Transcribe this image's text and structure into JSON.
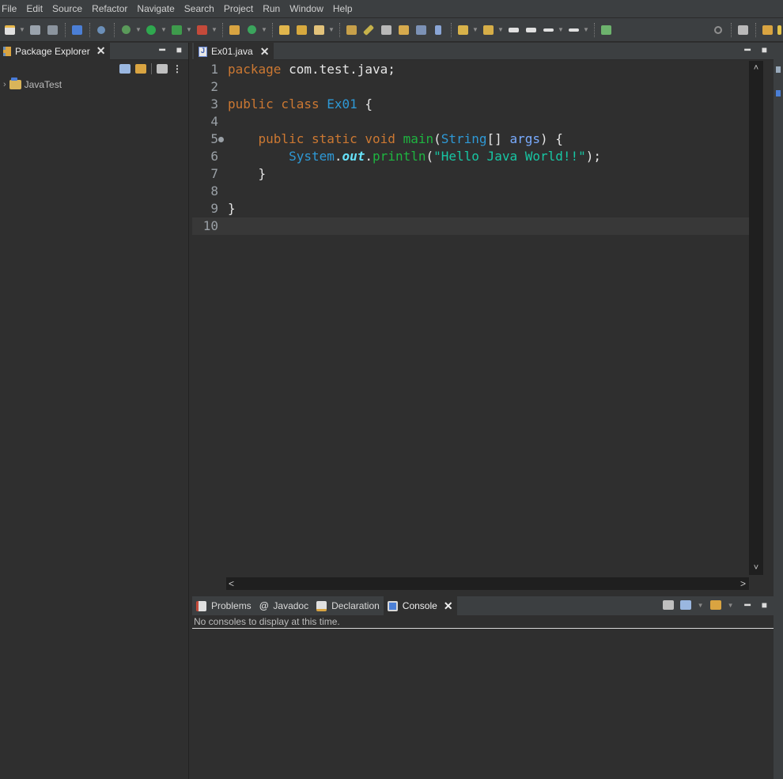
{
  "menu": [
    "File",
    "Edit",
    "Source",
    "Refactor",
    "Navigate",
    "Search",
    "Project",
    "Run",
    "Window",
    "Help"
  ],
  "left_panel": {
    "tab_label": "Package Explorer",
    "close_glyph": "✕",
    "tree": [
      {
        "label": "JavaTest",
        "expanded": false
      }
    ]
  },
  "editor": {
    "tab_label": "Ex01.java",
    "close_glyph": "✕",
    "line_numbers": [
      "1",
      "2",
      "3",
      "4",
      "5",
      "6",
      "7",
      "8",
      "9",
      "10"
    ],
    "current_line": 10
  },
  "bottom_panel": {
    "tabs": [
      {
        "label": "Problems",
        "active": false
      },
      {
        "label": "Javadoc",
        "active": false
      },
      {
        "label": "Declaration",
        "active": false
      },
      {
        "label": "Console",
        "active": true
      }
    ],
    "close_glyph": "✕",
    "console_message": "No consoles to display at this time."
  },
  "colors": {
    "background": "#2f2f2f",
    "keyword": "#cc7832",
    "class": "#2e99d6",
    "method": "#1eb540",
    "string": "#17c6a3"
  }
}
